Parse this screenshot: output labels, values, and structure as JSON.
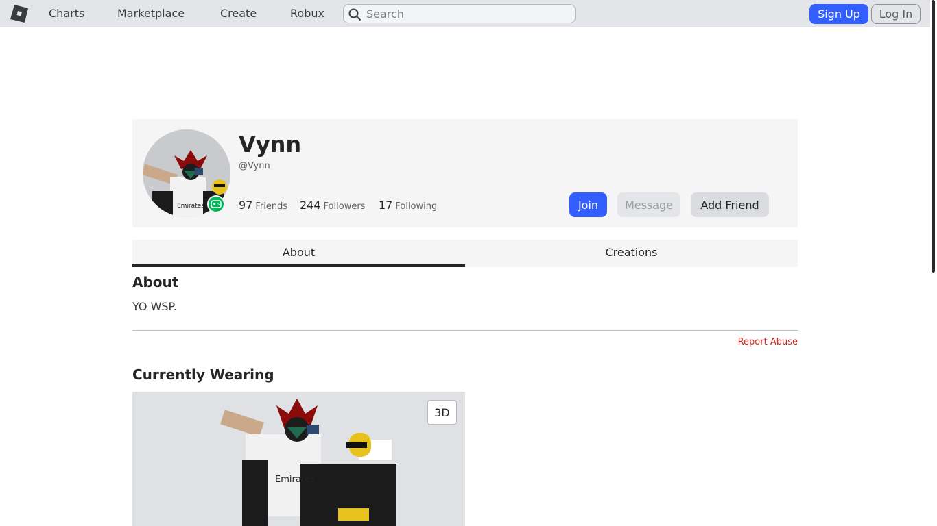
{
  "nav": {
    "links": [
      "Charts",
      "Marketplace",
      "Create",
      "Robux"
    ],
    "search_placeholder": "Search",
    "signup_label": "Sign Up",
    "login_label": "Log In"
  },
  "profile": {
    "display_name": "Vynn",
    "username": "@Vynn",
    "friends_count": "97",
    "friends_label": "Friends",
    "followers_count": "244",
    "followers_label": "Followers",
    "following_count": "17",
    "following_label": "Following",
    "join_label": "Join",
    "message_label": "Message",
    "add_friend_label": "Add Friend",
    "presence_icon": "gamepad-icon"
  },
  "tabs": [
    {
      "label": "About",
      "active": true
    },
    {
      "label": "Creations",
      "active": false
    }
  ],
  "about": {
    "title": "About",
    "text": "YO WSP.",
    "report_label": "Report Abuse"
  },
  "wearing": {
    "title": "Currently Wearing",
    "view_toggle_label": "3D"
  },
  "colors": {
    "primary": "#335fff",
    "presence": "#02b757",
    "report": "#d0261e"
  }
}
